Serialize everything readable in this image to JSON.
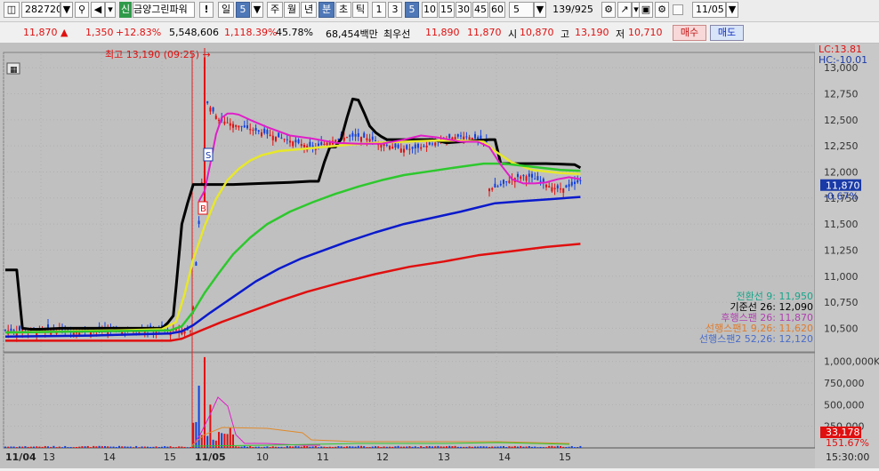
{
  "toolbar": {
    "code": "282720",
    "credit_badge": "신",
    "stock_name": "금양그린파워",
    "warn_label": "!",
    "period_label": "일",
    "period_num": "5",
    "tabs": [
      "주",
      "월",
      "년",
      "분",
      "초",
      "틱"
    ],
    "minute_options": [
      "1",
      "3",
      "5",
      "10",
      "15",
      "30",
      "45",
      "60"
    ],
    "count_value": "5",
    "page_counter": "139/925",
    "date_value": "11/05"
  },
  "quote": {
    "price": "11,870 ▲",
    "change": "1,350",
    "change_pct": "+12.83%",
    "volume": "5,548,606",
    "volume_ratio": "1,118.39%",
    "turnover": "45.78%",
    "amount": "68,454백만",
    "best_label": "최우선",
    "best_ask": "11,890",
    "best_bid": "11,870",
    "open_label": "시",
    "open": "10,870",
    "high_label": "고",
    "high": "13,190",
    "low_label": "저",
    "low": "10,710",
    "buy_label": "매수",
    "sell_label": "매도"
  },
  "chart_panel": {
    "high_marker": "최고 13,190 (09:25)",
    "lc_label": "LC:13.81",
    "hc_label": "HC:-10.01",
    "price_tag": "11,870",
    "price_tag_pct": "-0.67%",
    "vol_tag": "33,178",
    "vol_pct_tag": "151.67%",
    "signal_s": "S",
    "signal_b": "B",
    "footer_time": "15:30:00",
    "legend": [
      {
        "text": "전환선 9: 11,950",
        "color": "#17a58a"
      },
      {
        "text": "기준선 26: 12,090",
        "color": "#000000"
      },
      {
        "text": "후행스팬 26: 11,870",
        "color": "#b040b0"
      },
      {
        "text": "선행스팬1 9,26: 11,620",
        "color": "#e07b2b"
      },
      {
        "text": "선행스팬2 52,26: 12,120",
        "color": "#4a6cc8"
      }
    ]
  },
  "chart_data": {
    "type": "candlestick",
    "price_axis": {
      "ylim": [
        10290,
        13130
      ],
      "ticks": [
        10500,
        10750,
        11000,
        11250,
        11500,
        11750,
        12000,
        12250,
        12500,
        12750,
        13000
      ],
      "tick_labels": [
        "10,500",
        "10,750",
        "11,000",
        "11,250",
        "11,500",
        "11,750",
        "12,000",
        "12,250",
        "12,500",
        "12,750",
        "13,000"
      ]
    },
    "volume_axis": {
      "ylim": [
        0,
        1100000
      ],
      "ticks": [
        250000,
        500000,
        750000,
        1000000
      ],
      "tick_labels": [
        "250,000",
        "500,000",
        "750,000",
        "1,000,000K"
      ]
    },
    "x_labels": [
      "11/04",
      "13",
      "14",
      "15",
      "11/05",
      "10",
      "11",
      "12",
      "13",
      "14",
      "15"
    ],
    "n_bars": 139,
    "series": [
      {
        "name": "전환선 9",
        "color": "#000000",
        "points": [
          [
            0,
            11060
          ],
          [
            4,
            11060
          ],
          [
            6,
            10500
          ],
          [
            9,
            10490
          ],
          [
            12,
            10490
          ],
          [
            20,
            10500
          ],
          [
            30,
            10500
          ],
          [
            40,
            10500
          ],
          [
            50,
            10500
          ],
          [
            55,
            10500
          ],
          [
            57,
            10550
          ],
          [
            59,
            10620
          ],
          [
            60,
            10900
          ],
          [
            62,
            11500
          ],
          [
            64,
            11700
          ],
          [
            66,
            11880
          ],
          [
            70,
            11880
          ],
          [
            75,
            11880
          ],
          [
            80,
            11880
          ],
          [
            90,
            11890
          ],
          [
            100,
            11900
          ],
          [
            107,
            11910
          ],
          [
            110,
            11910
          ],
          [
            112,
            12090
          ],
          [
            114,
            12240
          ],
          [
            116,
            12240
          ],
          [
            118,
            12320
          ],
          [
            120,
            12520
          ],
          [
            122,
            12700
          ],
          [
            124,
            12690
          ],
          [
            126,
            12570
          ],
          [
            128,
            12440
          ],
          [
            130,
            12380
          ],
          [
            132,
            12340
          ],
          [
            134,
            12310
          ],
          [
            137,
            12310
          ],
          [
            140,
            12310
          ],
          [
            146,
            12310
          ],
          [
            150,
            12310
          ],
          [
            155,
            12280
          ],
          [
            160,
            12290
          ],
          [
            165,
            12300
          ],
          [
            170,
            12310
          ],
          [
            172,
            12310
          ],
          [
            174,
            12080
          ],
          [
            180,
            12080
          ],
          [
            190,
            12080
          ],
          [
            200,
            12070
          ],
          [
            202,
            12040
          ]
        ]
      },
      {
        "name": "기준선 26",
        "color": "#e7e72b",
        "points": [
          [
            0,
            10460
          ],
          [
            20,
            10470
          ],
          [
            40,
            10480
          ],
          [
            55,
            10490
          ],
          [
            60,
            10560
          ],
          [
            63,
            10830
          ],
          [
            66,
            11160
          ],
          [
            70,
            11480
          ],
          [
            74,
            11740
          ],
          [
            78,
            11920
          ],
          [
            82,
            12030
          ],
          [
            86,
            12110
          ],
          [
            90,
            12160
          ],
          [
            96,
            12200
          ],
          [
            104,
            12220
          ],
          [
            112,
            12240
          ],
          [
            120,
            12260
          ],
          [
            130,
            12280
          ],
          [
            140,
            12290
          ],
          [
            150,
            12300
          ],
          [
            160,
            12300
          ],
          [
            168,
            12290
          ],
          [
            172,
            12200
          ],
          [
            178,
            12090
          ],
          [
            185,
            12020
          ],
          [
            195,
            11990
          ],
          [
            202,
            11980
          ]
        ]
      },
      {
        "name": "선행스팬2",
        "color": "#2dc82d",
        "points": [
          [
            0,
            10460
          ],
          [
            30,
            10470
          ],
          [
            58,
            10480
          ],
          [
            62,
            10520
          ],
          [
            66,
            10660
          ],
          [
            70,
            10840
          ],
          [
            75,
            11030
          ],
          [
            80,
            11210
          ],
          [
            86,
            11370
          ],
          [
            92,
            11500
          ],
          [
            100,
            11620
          ],
          [
            108,
            11710
          ],
          [
            116,
            11790
          ],
          [
            124,
            11860
          ],
          [
            132,
            11920
          ],
          [
            140,
            11970
          ],
          [
            150,
            12010
          ],
          [
            160,
            12050
          ],
          [
            168,
            12080
          ],
          [
            175,
            12080
          ],
          [
            185,
            12050
          ],
          [
            195,
            12020
          ],
          [
            202,
            12010
          ]
        ]
      },
      {
        "name": "선행스팬1",
        "color": "#0a1acc",
        "points": [
          [
            0,
            10420
          ],
          [
            30,
            10430
          ],
          [
            58,
            10450
          ],
          [
            62,
            10470
          ],
          [
            66,
            10530
          ],
          [
            72,
            10650
          ],
          [
            80,
            10800
          ],
          [
            88,
            10950
          ],
          [
            96,
            11070
          ],
          [
            104,
            11170
          ],
          [
            112,
            11250
          ],
          [
            120,
            11330
          ],
          [
            130,
            11420
          ],
          [
            140,
            11500
          ],
          [
            150,
            11560
          ],
          [
            160,
            11620
          ],
          [
            166,
            11660
          ],
          [
            172,
            11700
          ],
          [
            182,
            11720
          ],
          [
            192,
            11740
          ],
          [
            202,
            11760
          ]
        ]
      },
      {
        "name": "후행스팬",
        "color": "#e00f0f",
        "points": [
          [
            0,
            10380
          ],
          [
            58,
            10380
          ],
          [
            62,
            10400
          ],
          [
            68,
            10470
          ],
          [
            76,
            10560
          ],
          [
            86,
            10660
          ],
          [
            96,
            10760
          ],
          [
            106,
            10850
          ],
          [
            118,
            10940
          ],
          [
            130,
            11020
          ],
          [
            142,
            11090
          ],
          [
            154,
            11140
          ],
          [
            166,
            11200
          ],
          [
            178,
            11240
          ],
          [
            190,
            11280
          ],
          [
            202,
            11310
          ]
        ]
      },
      {
        "name": "magenta",
        "color": "#e01ec8",
        "points": [
          [
            68,
            11720
          ],
          [
            70,
            11820
          ],
          [
            72,
            12080
          ],
          [
            74,
            12360
          ],
          [
            76,
            12520
          ],
          [
            78,
            12560
          ],
          [
            80,
            12560
          ],
          [
            82,
            12550
          ],
          [
            86,
            12500
          ],
          [
            92,
            12430
          ],
          [
            100,
            12350
          ],
          [
            108,
            12320
          ],
          [
            116,
            12280
          ],
          [
            124,
            12270
          ],
          [
            132,
            12270
          ],
          [
            140,
            12310
          ],
          [
            146,
            12350
          ],
          [
            152,
            12330
          ],
          [
            160,
            12290
          ],
          [
            166,
            12290
          ],
          [
            170,
            12240
          ],
          [
            174,
            12070
          ],
          [
            178,
            11930
          ],
          [
            182,
            11890
          ],
          [
            186,
            11890
          ],
          [
            190,
            11900
          ],
          [
            194,
            11930
          ],
          [
            198,
            11950
          ],
          [
            202,
            11930
          ]
        ]
      }
    ]
  }
}
